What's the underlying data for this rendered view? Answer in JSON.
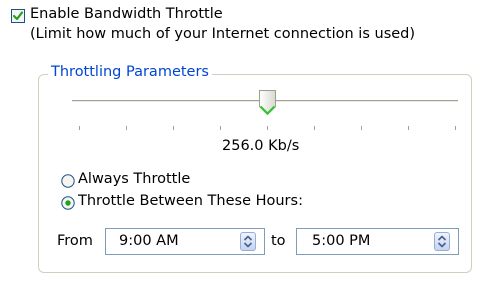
{
  "throttle": {
    "enabled": true,
    "enable_label": "Enable Bandwidth Throttle",
    "enable_note": "(Limit how much of your Internet connection is used)"
  },
  "parameters": {
    "group_title": "Throttling Parameters",
    "rate_label": "256.0 Kb/s",
    "slider_position_fraction": 0.5,
    "tick_count": 9
  },
  "mode": {
    "options": [
      {
        "label": "Always Throttle",
        "selected": false
      },
      {
        "label": "Throttle Between These Hours:",
        "selected": true
      }
    ]
  },
  "hours": {
    "from_label": "From",
    "from_value": "9:00 AM",
    "to_label": "to",
    "to_value": "5:00 PM"
  },
  "icons": {
    "checkbox": "checkmark-icon",
    "slider_thumb": "slider-thumb-icon",
    "spinner": "up-down-spinner-icon"
  },
  "colors": {
    "group_title": "#0046d5",
    "checkmark": "#21a121",
    "radio_dot": "#21a121",
    "control_border": "#1c5180"
  }
}
